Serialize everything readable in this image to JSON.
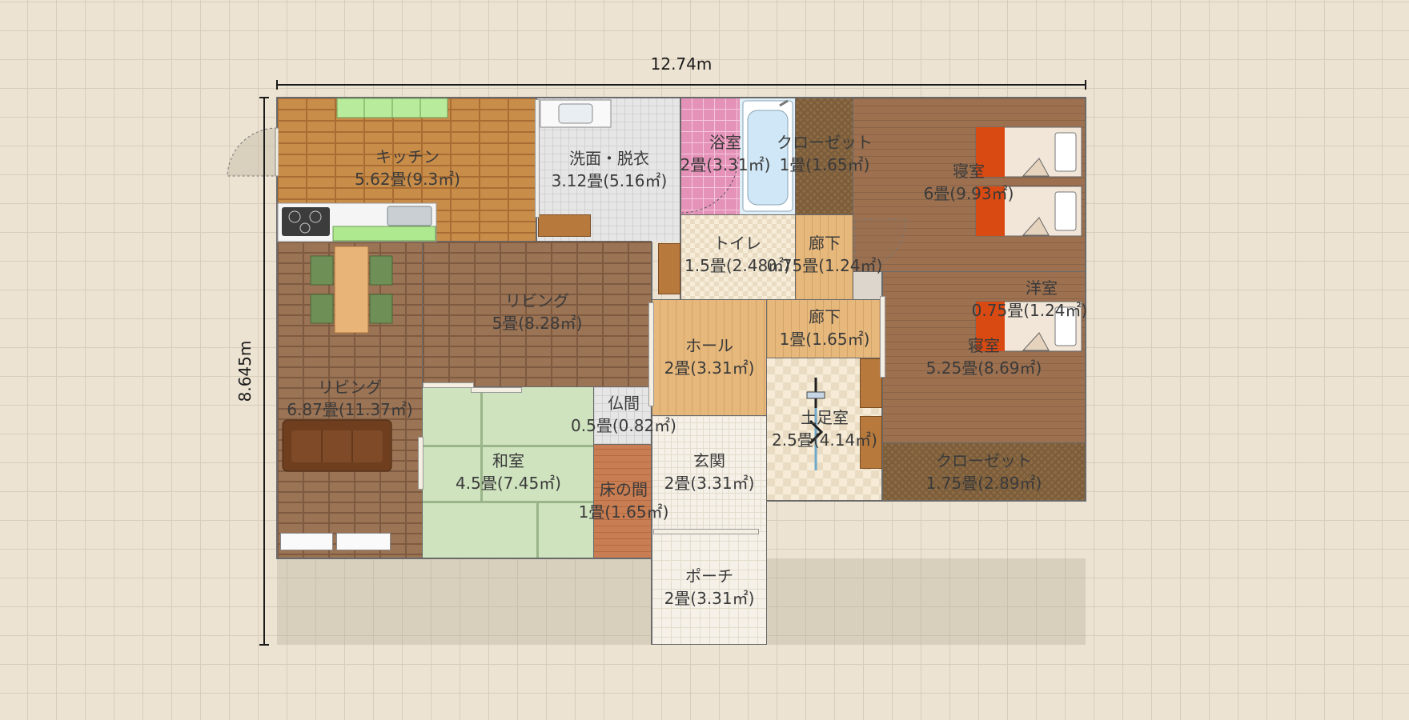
{
  "colors": {
    "grid_background": "#ece3d3",
    "grid_line": "#d8cdb9",
    "wall": "#6a6a6a",
    "dimension_line": "#1a1a1a"
  },
  "dimensions": {
    "width_label": "12.74m",
    "height_label": "8.645m"
  },
  "rooms": {
    "kitchen": {
      "name": "キッチン",
      "area": "5.62畳(9.3㎡)"
    },
    "washroom": {
      "name": "洗面・脱衣",
      "area": "3.12畳(5.16㎡)"
    },
    "bathroom": {
      "name": "浴室",
      "area": "2畳(3.31㎡)"
    },
    "closet_top": {
      "name": "クローゼット",
      "area": "1畳(1.65㎡)"
    },
    "bedroom_top": {
      "name": "寝室",
      "area": "6畳(9.93㎡)"
    },
    "toilet": {
      "name": "トイレ",
      "area": "1.5畳(2.48㎡)"
    },
    "hallway_top": {
      "name": "廊下",
      "area": "0.75畳(1.24㎡)"
    },
    "western_room": {
      "name": "洋室",
      "area": "0.75畳(1.24㎡)"
    },
    "living_center": {
      "name": "リビング",
      "area": "5畳(8.28㎡)"
    },
    "living_left": {
      "name": "リビング",
      "area": "6.87畳(11.37㎡)"
    },
    "hall": {
      "name": "ホール",
      "area": "2畳(3.31㎡)"
    },
    "hallway_mid": {
      "name": "廊下",
      "area": "1畳(1.65㎡)"
    },
    "bedroom_right": {
      "name": "寝室",
      "area": "5.25畳(8.69㎡)"
    },
    "butsuma": {
      "name": "仏間",
      "area": "0.5畳(0.82㎡)"
    },
    "doma": {
      "name": "土足室",
      "area": "2.5畳(4.14㎡)"
    },
    "japanese_room": {
      "name": "和室",
      "area": "4.5畳(7.45㎡)"
    },
    "entrance": {
      "name": "玄関",
      "area": "2畳(3.31㎡)"
    },
    "closet_bottom": {
      "name": "クローゼット",
      "area": "1.75畳(2.89㎡)"
    },
    "tokonoma": {
      "name": "床の間",
      "area": "1畳(1.65㎡)"
    },
    "porch": {
      "name": "ポーチ",
      "area": "2畳(3.31㎡)"
    }
  },
  "icons": [
    "sofa-icon",
    "dining-table-icon",
    "bed-icon",
    "stove-icon",
    "sink-icon",
    "bathtub-icon",
    "toilet-icon",
    "bicycle-icon",
    "door-swing-icon"
  ]
}
